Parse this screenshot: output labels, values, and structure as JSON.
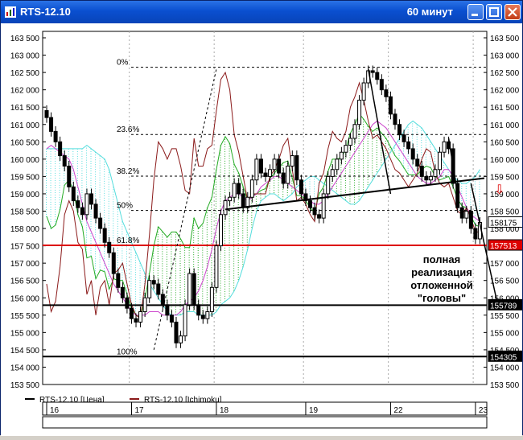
{
  "window": {
    "title": "RTS-12.10",
    "timeframe": "60 минут",
    "buttons": [
      "minimize",
      "maximize",
      "close"
    ]
  },
  "chart_data": {
    "type": "candlestick",
    "y_ticks": [
      "163 500",
      "163 000",
      "162 500",
      "162 000",
      "161 500",
      "161 000",
      "160 500",
      "160 000",
      "159 500",
      "159 000",
      "158 500",
      "158 000",
      "157 500",
      "157 000",
      "156 500",
      "156 000",
      "155 500",
      "155 000",
      "154 500",
      "154 000",
      "153 500"
    ],
    "ylim": [
      153500,
      163500
    ],
    "x_ticks": [
      {
        "label": "16",
        "bar": 0
      },
      {
        "label": "17",
        "bar": 19
      },
      {
        "label": "18",
        "bar": 38
      },
      {
        "label": "19",
        "bar": 58
      },
      {
        "label": "22",
        "bar": 77
      },
      {
        "label": "23",
        "bar": 96
      }
    ],
    "price_labels": [
      {
        "text": "158175",
        "value": 158175,
        "bg": "#ffffff",
        "color": "#000000"
      },
      {
        "text": "157513",
        "value": 157513,
        "bg": "#dd0000",
        "color": "#ffffff"
      },
      {
        "text": "155789",
        "value": 155789,
        "bg": "#000000",
        "color": "#ffffff"
      },
      {
        "text": "154305",
        "value": 154305,
        "bg": "#000000",
        "color": "#ffffff"
      }
    ],
    "fib_levels": [
      {
        "label": "0%",
        "value": 162650
      },
      {
        "label": "23.6%",
        "value": 160710
      },
      {
        "label": "38.2%",
        "value": 159510
      },
      {
        "label": "50%",
        "value": 158520
      },
      {
        "label": "61.8%",
        "value": 157513
      },
      {
        "label": "100%",
        "value": 154305
      }
    ],
    "annotation": [
      "полная",
      "реализация",
      "отложенной",
      "\"головы\""
    ],
    "down_arrow": "⇩",
    "legend": [
      {
        "name": "RTS-12.10 [Цена]",
        "color": "#000000"
      },
      {
        "name": "RTS-12.10 [Ichimoku]",
        "color": "#8b1a1a"
      }
    ],
    "colors": {
      "cloud_green": "#22aa22",
      "cloud_cyan": "#55dddd",
      "tenkan": "#8b1a1a",
      "kijun": "#cc44cc",
      "support": "#dd0000",
      "neckline": "#000000"
    },
    "close": [
      161200,
      160800,
      160500,
      160100,
      159800,
      159200,
      158800,
      158600,
      158400,
      159000,
      158700,
      158300,
      158000,
      157600,
      157300,
      156700,
      156300,
      156000,
      155700,
      155400,
      155300,
      155600,
      156000,
      156500,
      156400,
      156100,
      155800,
      155500,
      155300,
      154700,
      154900,
      155800,
      156700,
      155800,
      155500,
      155400,
      155600,
      156300,
      157500,
      158400,
      158800,
      158900,
      159300,
      159000,
      158600,
      158900,
      159400,
      160000,
      159600,
      159500,
      159700,
      160000,
      159600,
      159300,
      159800,
      160100,
      159400,
      159000,
      158800,
      158600,
      158400,
      158300,
      159000,
      159500,
      159700,
      160000,
      160200,
      160400,
      160600,
      161000,
      161700,
      162200,
      162550,
      162500,
      162300,
      162000,
      161800,
      161300,
      161000,
      160700,
      160500,
      160300,
      160000,
      159800,
      159500,
      159400,
      159500,
      159700,
      160200,
      160500,
      160300,
      159300,
      158600,
      158300,
      158500,
      158000,
      157700,
      158175
    ],
    "ichimoku": {
      "tenkan": [
        156400,
        155600,
        155900,
        156900,
        158400,
        158800,
        158500,
        157600,
        157400,
        156100,
        156500,
        155500,
        156300,
        156500,
        155800,
        156700,
        156800,
        157000,
        156400,
        155800,
        155500,
        155400,
        156400,
        157800,
        159400,
        160500,
        160300,
        160000,
        160300,
        160300,
        159800,
        159100,
        159000,
        160600,
        159800,
        159800,
        160300,
        160400,
        161400,
        162300,
        162500,
        162000,
        160700,
        160200,
        159500,
        158800,
        159000,
        159000,
        159000,
        159000,
        159500,
        159700,
        160000,
        160400,
        160600,
        159700,
        158800,
        158900,
        158700,
        158400,
        158200,
        159300,
        159600,
        160300,
        160800,
        160600,
        160500,
        160800,
        161500,
        161800,
        162200,
        161700,
        161100,
        160600,
        160700,
        160500,
        160300,
        160000,
        159700,
        159600,
        159400,
        159200,
        159400,
        159600,
        160000,
        160300,
        160200,
        159600,
        159300,
        159200,
        159300,
        158900,
        158500,
        158400,
        158600,
        158300,
        157900,
        157900
      ],
      "kijun": [
        160300,
        160400,
        160300,
        160200,
        160100,
        160000,
        159700,
        159200,
        158700,
        158200,
        157900,
        157600,
        157300,
        157000,
        156700,
        156400,
        156200,
        156000,
        155800,
        155600,
        155500,
        155500,
        155500,
        155600,
        155600,
        155600,
        155500,
        155500,
        155500,
        155500,
        155600,
        155800,
        155900,
        156000,
        156200,
        156500,
        156900,
        157400,
        158000,
        158500,
        158800,
        158900,
        159000,
        159000,
        158900,
        158800,
        158900,
        159000,
        159200,
        159300,
        159400,
        159500,
        159500,
        159400,
        159300,
        159200,
        159100,
        159000,
        158900,
        158800,
        158700,
        158700,
        158800,
        159000,
        159200,
        159400,
        159600,
        159800,
        160000,
        160200,
        160400,
        160600,
        160800,
        161000,
        161100,
        161000,
        160900,
        160700,
        160500,
        160300,
        160100,
        159900,
        159700,
        159500,
        159400,
        159300,
        159300,
        159400,
        159500,
        159700,
        159700,
        159500,
        159200,
        158900,
        158600,
        158400,
        158300,
        158200
      ]
    }
  }
}
